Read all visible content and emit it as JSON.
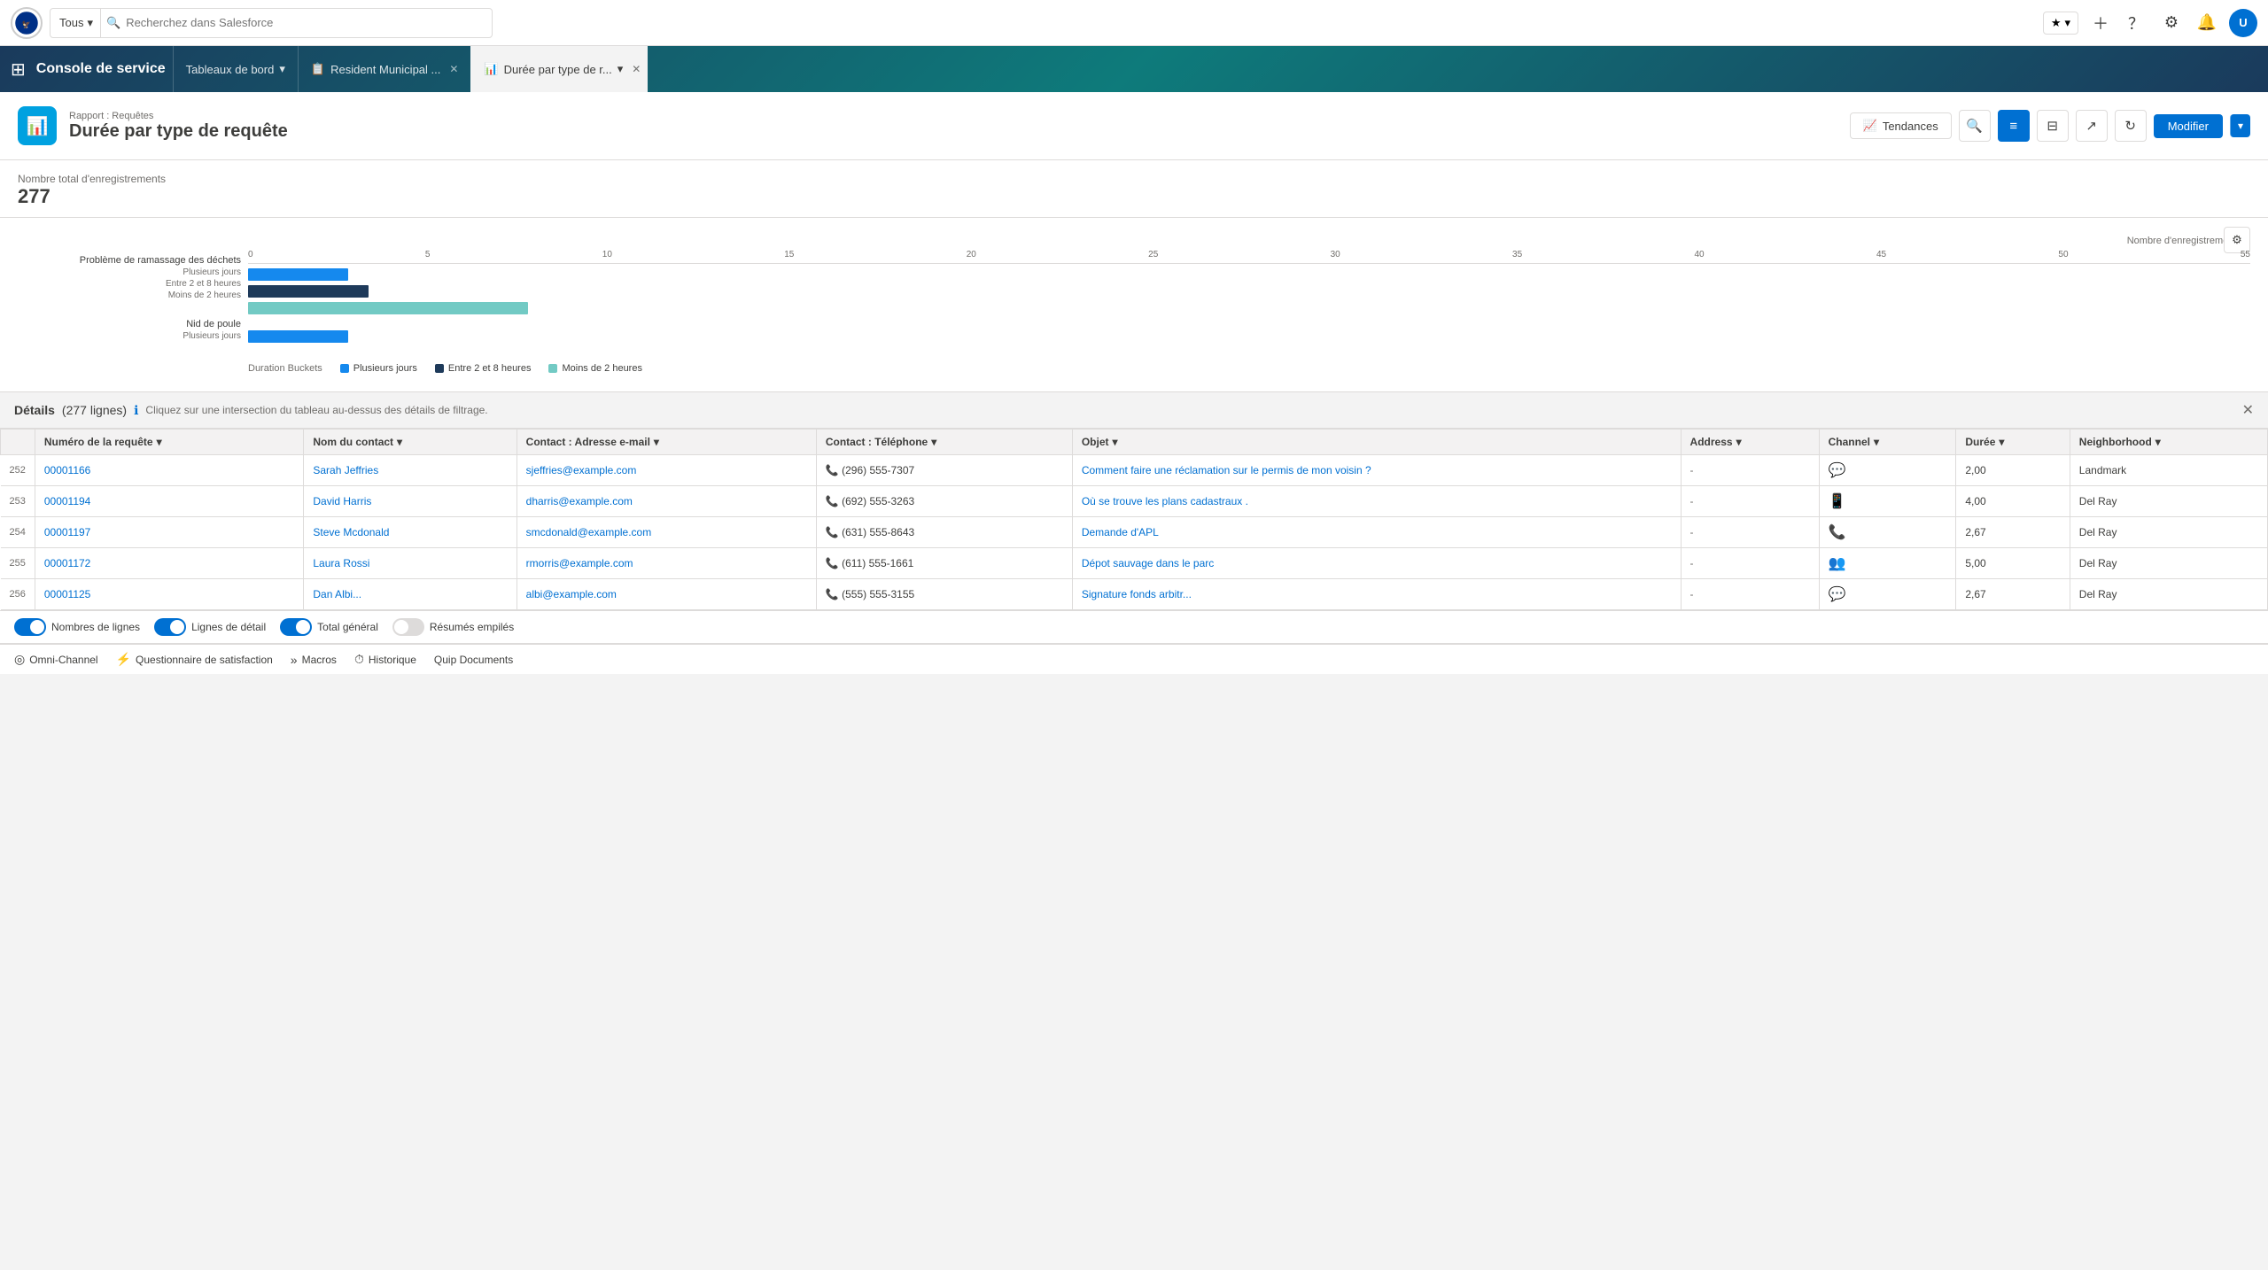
{
  "topNav": {
    "scope": "Tous",
    "searchPlaceholder": "Recherchez dans Salesforce",
    "appTitle": "Console de service"
  },
  "tabs": [
    {
      "id": "tableaux",
      "label": "Tableaux de bord",
      "icon": "📊",
      "active": false,
      "closeable": false,
      "dropdown": true
    },
    {
      "id": "resident",
      "label": "Resident Municipal ...",
      "icon": "📋",
      "active": false,
      "closeable": true
    },
    {
      "id": "duree",
      "label": "Durée par type de r...",
      "icon": "📊",
      "active": true,
      "closeable": true
    }
  ],
  "report": {
    "subtitle": "Rapport : Requêtes",
    "title": "Durée par type de requête",
    "iconLabel": "📊",
    "buttons": {
      "tendances": "Tendances",
      "modifier": "Modifier"
    }
  },
  "stats": {
    "label": "Nombre total d'enregistrements",
    "value": "277"
  },
  "chart": {
    "xAxisLabel": "Nombre d'enregistrements",
    "xTicks": [
      "0",
      "5",
      "10",
      "15",
      "20",
      "25",
      "30",
      "35",
      "40",
      "45",
      "50",
      "55"
    ],
    "groups": [
      {
        "category": "Problème de ramassage des déchets",
        "bars": [
          {
            "label": "Plusieurs jours",
            "width": 4,
            "color": "blue"
          },
          {
            "label": "Entre 2 et 8 heures",
            "width": 5,
            "color": "navy"
          },
          {
            "label": "Moins de 2 heures",
            "width": 12,
            "color": "teal"
          }
        ]
      },
      {
        "category": "Nid de poule",
        "bars": [
          {
            "label": "Plusieurs jours",
            "width": 4,
            "color": "blue"
          }
        ]
      }
    ],
    "legend": {
      "title": "Duration Buckets",
      "items": [
        {
          "label": "Plusieurs jours",
          "color": "#1589ee"
        },
        {
          "label": "Entre 2 et 8 heures",
          "color": "#1e3a5a"
        },
        {
          "label": "Moins de 2 heures",
          "color": "#72cac4"
        }
      ]
    }
  },
  "details": {
    "title": "Détails",
    "count": "(277 lignes)",
    "hint": "Cliquez sur une intersection du tableau au-dessus des détails de filtrage."
  },
  "tableHeaders": [
    {
      "id": "num",
      "label": ""
    },
    {
      "id": "requete",
      "label": "Numéro de la requête"
    },
    {
      "id": "contact",
      "label": "Nom du contact"
    },
    {
      "id": "email",
      "label": "Contact : Adresse e-mail"
    },
    {
      "id": "tel",
      "label": "Contact : Téléphone"
    },
    {
      "id": "objet",
      "label": "Objet"
    },
    {
      "id": "address",
      "label": "Address"
    },
    {
      "id": "channel",
      "label": "Channel"
    },
    {
      "id": "duree",
      "label": "Durée"
    },
    {
      "id": "neighborhood",
      "label": "Neighborhood"
    }
  ],
  "tableRows": [
    {
      "num": "252",
      "requete": "00001166",
      "contact": "Sarah Jeffries",
      "email": "sjeffries@example.com",
      "tel": "(296) 555-7307",
      "objet": "Comment faire une réclamation sur le permis de mon voisin ?",
      "address": "-",
      "channel": "chat",
      "duree": "2,00",
      "neighborhood": "Landmark"
    },
    {
      "num": "253",
      "requete": "00001194",
      "contact": "David Harris",
      "email": "dharris@example.com",
      "tel": "(692) 555-3263",
      "objet": "Où se trouve les plans cadastraux .",
      "address": "-",
      "channel": "mobile",
      "duree": "4,00",
      "neighborhood": "Del Ray"
    },
    {
      "num": "254",
      "requete": "00001197",
      "contact": "Steve Mcdonald",
      "email": "smcdonald@example.com",
      "tel": "(631) 555-8643",
      "objet": "Demande d'APL",
      "address": "-",
      "channel": "phone",
      "duree": "2,67",
      "neighborhood": "Del Ray"
    },
    {
      "num": "255",
      "requete": "00001172",
      "contact": "Laura Rossi",
      "email": "rmorris@example.com",
      "tel": "(611) 555-1661",
      "objet": "Dépot sauvage dans le parc",
      "address": "-",
      "channel": "group",
      "duree": "5,00",
      "neighborhood": "Del Ray"
    },
    {
      "num": "256",
      "requete": "00001125",
      "contact": "Dan Albi...",
      "email": "albi@example.com",
      "tel": "(555) 555-3155",
      "objet": "Signature fonds arbitr...",
      "address": "-",
      "channel": "chat",
      "duree": "2,67",
      "neighborhood": "Del Ray"
    }
  ],
  "channelIcons": {
    "chat": "💬",
    "mobile": "📱",
    "phone": "📞",
    "group": "👥"
  },
  "bottomBar": {
    "toggles": [
      {
        "label": "Nombres de lignes",
        "state": "on"
      },
      {
        "label": "Lignes de détail",
        "state": "on"
      },
      {
        "label": "Total général",
        "state": "on"
      },
      {
        "label": "Résumés empilés",
        "state": "off"
      }
    ]
  },
  "footerNav": {
    "items": [
      {
        "icon": "◎",
        "label": "Omni-Channel"
      },
      {
        "icon": "⚡",
        "label": "Questionnaire de satisfaction"
      },
      {
        "icon": "»",
        "label": "Macros"
      },
      {
        "icon": "⏱",
        "label": "Historique"
      },
      {
        "icon": "",
        "label": "Quip Documents"
      }
    ]
  }
}
